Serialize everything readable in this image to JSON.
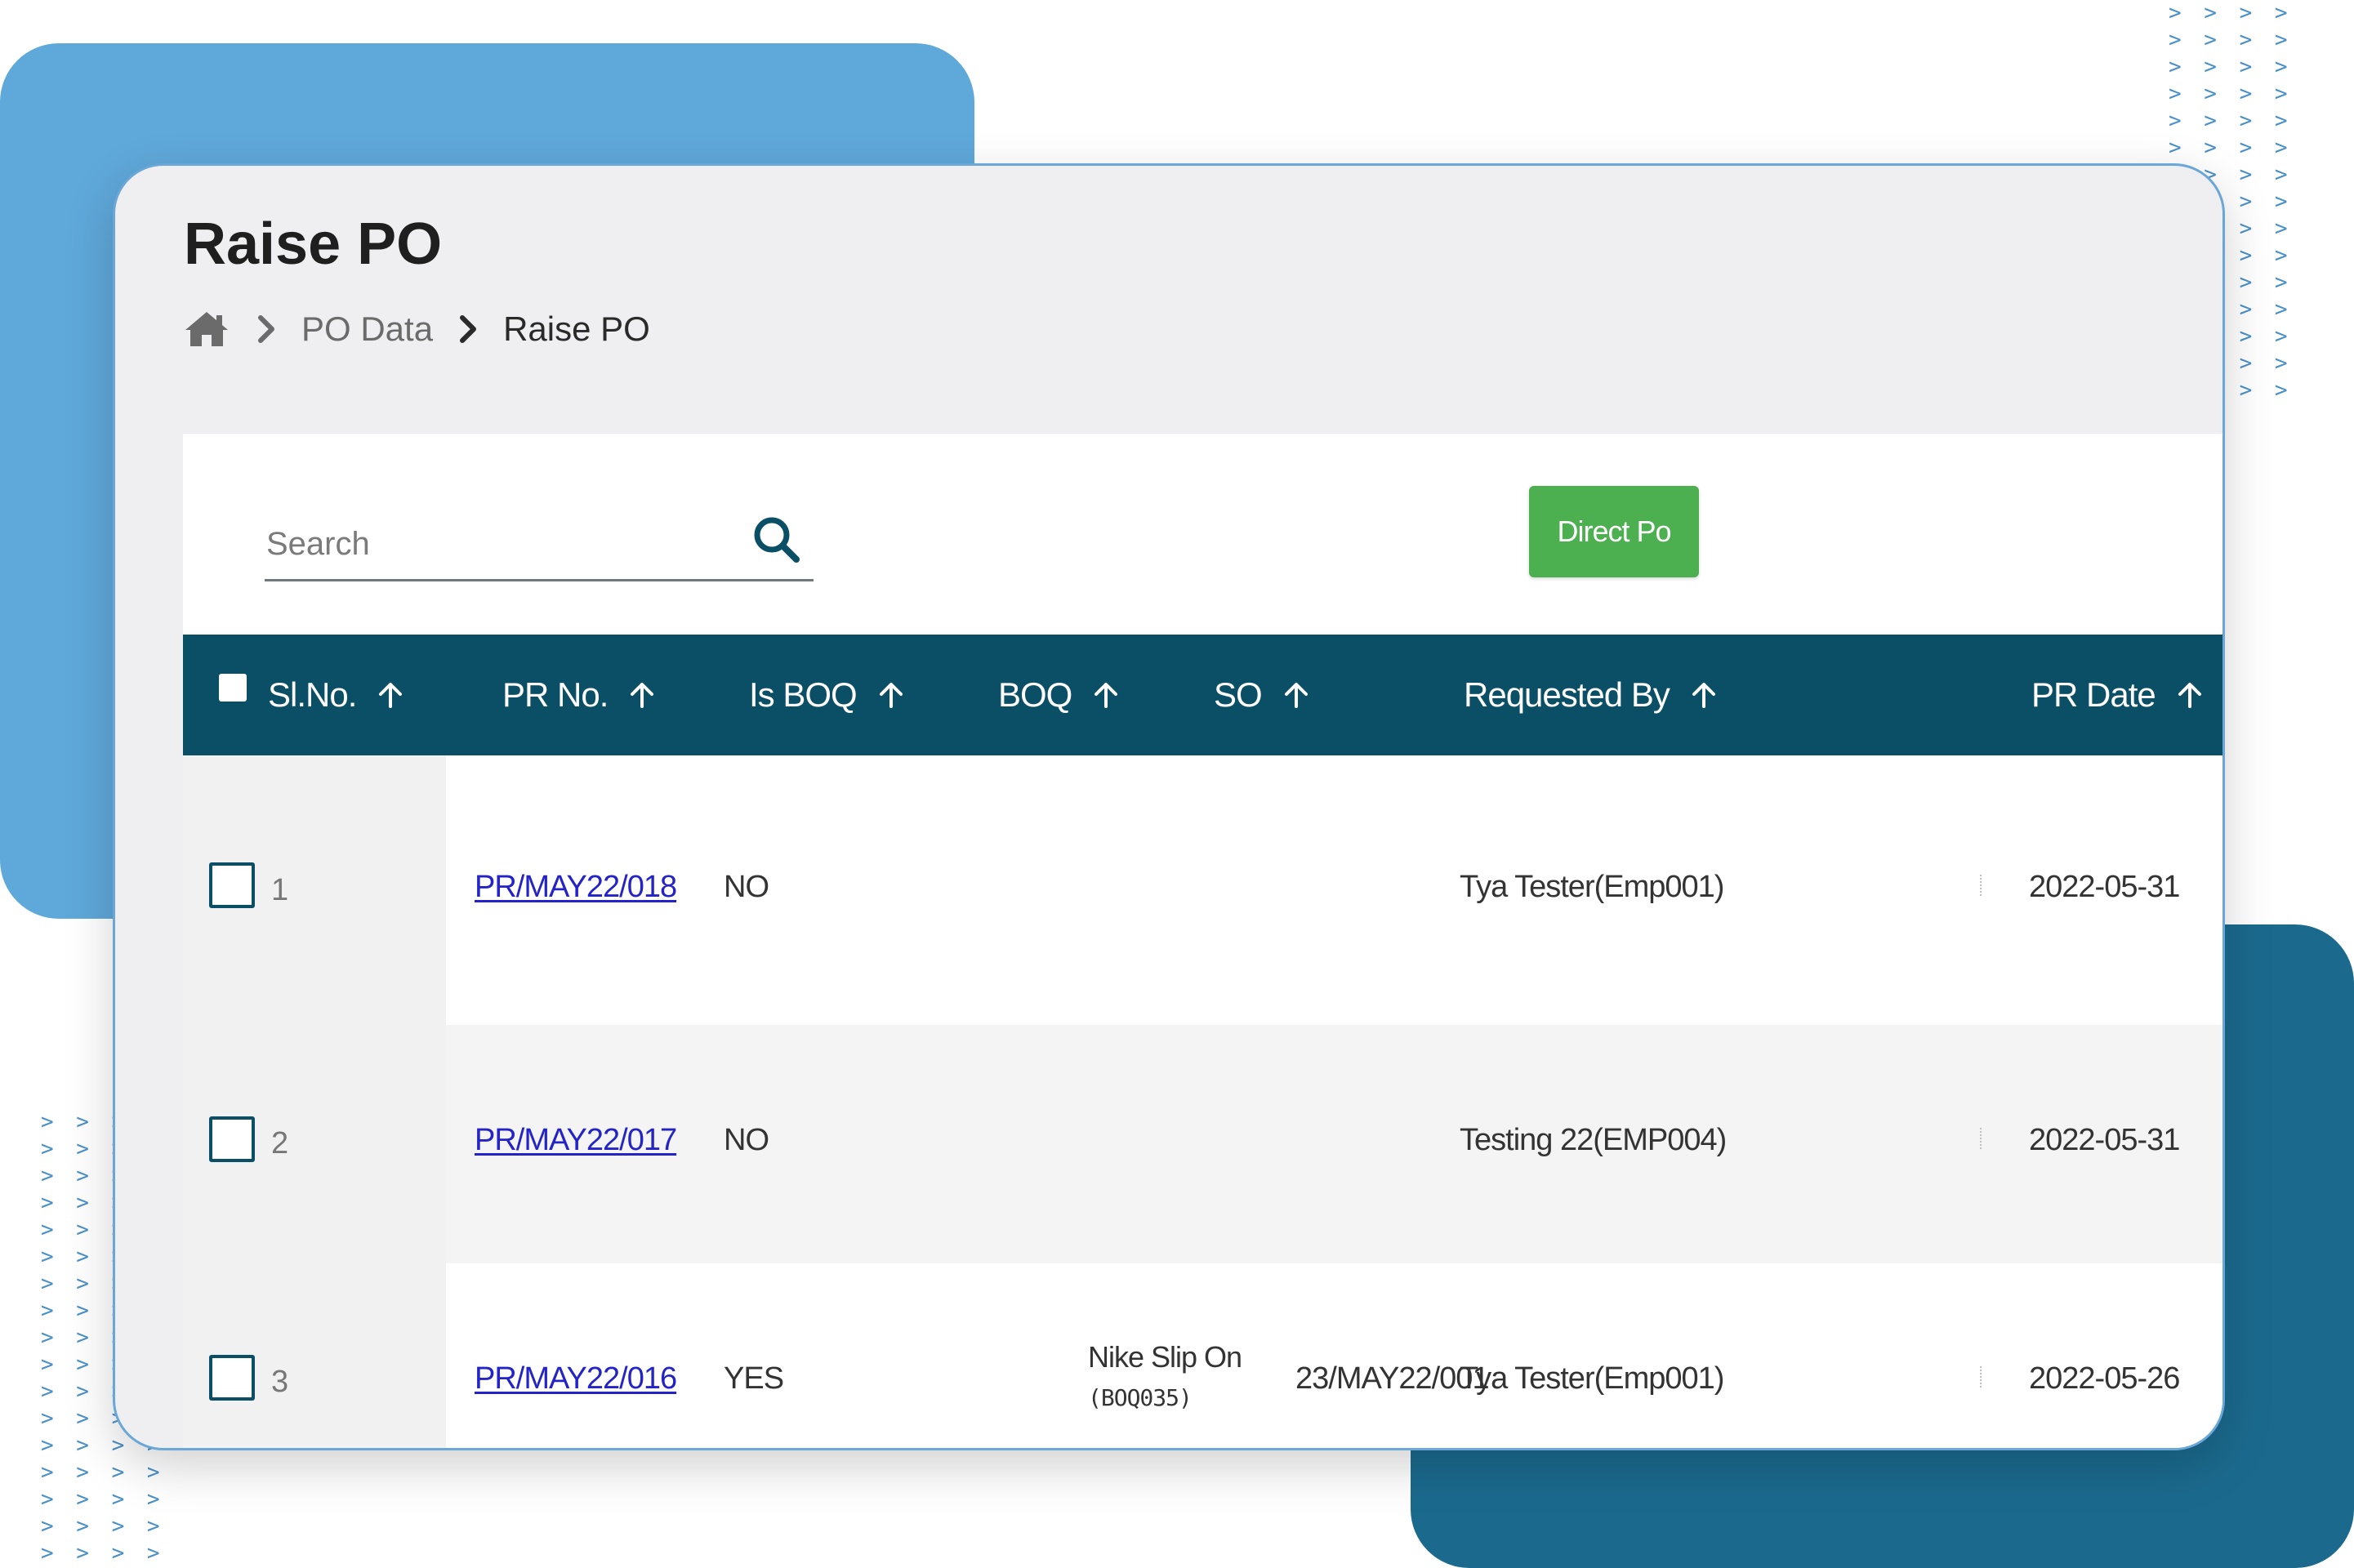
{
  "page": {
    "title": "Raise PO",
    "breadcrumb": {
      "home_icon": "home-icon",
      "items": [
        "PO Data",
        "Raise PO"
      ]
    }
  },
  "toolbar": {
    "search_placeholder": "Search",
    "search_icon": "search-icon",
    "direct_po_label": "Direct Po"
  },
  "table": {
    "columns": [
      "Sl.No.",
      "PR No.",
      "Is BOQ",
      "BOQ",
      "SO",
      "Requested By",
      "PR Date"
    ],
    "sort_icon": "arrow-up-icon",
    "rows": [
      {
        "sl": "1",
        "pr_no": "PR/MAY22/018",
        "is_boq": "NO",
        "boq": "",
        "boq_code": "",
        "so": "",
        "requested_by": "Tya Tester(Emp001)",
        "pr_date": "2022-05-31"
      },
      {
        "sl": "2",
        "pr_no": "PR/MAY22/017",
        "is_boq": "NO",
        "boq": "",
        "boq_code": "",
        "so": "",
        "requested_by": "Testing 22(EMP004)",
        "pr_date": "2022-05-31"
      },
      {
        "sl": "3",
        "pr_no": "PR/MAY22/016",
        "is_boq": "YES",
        "boq": "Nike Slip On",
        "boq_code": "(BOQ035)",
        "so": "23/MAY22/001",
        "requested_by": "Tya Tester(Emp001)",
        "pr_date": "2022-05-26"
      }
    ]
  },
  "colors": {
    "header_bg": "#0b4f67",
    "button_green": "#4caf50",
    "link_blue": "#2323c8",
    "accent_blue": "#5fa8da",
    "accent_teal": "#1b6a8e"
  }
}
